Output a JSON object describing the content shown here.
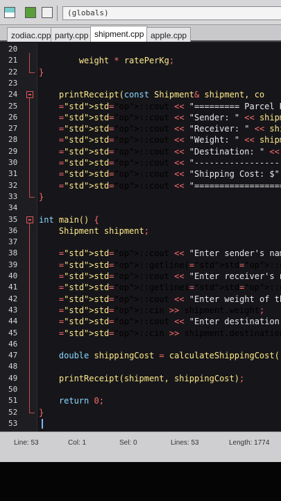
{
  "toolbar": {
    "scope_field": "(globals)"
  },
  "tabs": [
    {
      "label": "zodiac.cpp"
    },
    {
      "label": "party.cpp"
    },
    {
      "label": "shipment.cpp"
    },
    {
      "label": "apple.cpp"
    }
  ],
  "lines": [
    {
      "num": "20",
      "text": ""
    },
    {
      "num": "21",
      "text": "        weight * ratePerKg;"
    },
    {
      "num": "22",
      "text": "}"
    },
    {
      "num": "23",
      "text": ""
    },
    {
      "num": "24",
      "text": "    printReceipt(const Shipment& shipment, co"
    },
    {
      "num": "25",
      "text": "    std::cout << \"========= Parcel Receipt =="
    },
    {
      "num": "26",
      "text": "    std::cout << \"Sender: \" << shipment.sender"
    },
    {
      "num": "27",
      "text": "    std::cout << \"Receiver: \" << shipment.rece"
    },
    {
      "num": "28",
      "text": "    std::cout << \"Weight: \" << shipment.weight"
    },
    {
      "num": "29",
      "text": "    std::cout << \"Destination: \" << shipment.d"
    },
    {
      "num": "30",
      "text": "    std::cout << \"--------------------------------"
    },
    {
      "num": "31",
      "text": "    std::cout << \"Shipping Cost: $\" << std::fi"
    },
    {
      "num": "32",
      "text": "    std::cout << \"=============================="
    },
    {
      "num": "33",
      "text": "}"
    },
    {
      "num": "34",
      "text": ""
    },
    {
      "num": "35",
      "text": "int main() {"
    },
    {
      "num": "36",
      "text": "    Shipment shipment;"
    },
    {
      "num": "37",
      "text": ""
    },
    {
      "num": "38",
      "text": "    std::cout << \"Enter sender's name: \";"
    },
    {
      "num": "39",
      "text": "    std::getline(std::cin >> std::ws, shipment."
    },
    {
      "num": "40",
      "text": "    std::cout << \"Enter receiver's name: \";"
    },
    {
      "num": "41",
      "text": "    std::getline(std::cin >> std::ws, shipment."
    },
    {
      "num": "42",
      "text": "    std::cout << \"Enter weight of the shipment"
    },
    {
      "num": "43",
      "text": "    std::cin >> shipment.weight;"
    },
    {
      "num": "44",
      "text": "    std::cout << \"Enter destination (Domestic or"
    },
    {
      "num": "45",
      "text": "    std::cin >> shipment.destination;"
    },
    {
      "num": "46",
      "text": ""
    },
    {
      "num": "47",
      "text": "    double shippingCost = calculateShippingCost("
    },
    {
      "num": "48",
      "text": ""
    },
    {
      "num": "49",
      "text": "    printReceipt(shipment, shippingCost);"
    },
    {
      "num": "50",
      "text": ""
    },
    {
      "num": "51",
      "text": "    return 0;"
    },
    {
      "num": "52",
      "text": "}"
    },
    {
      "num": "53",
      "text": ""
    }
  ],
  "status": {
    "line_label": "Line:",
    "line_value": "53",
    "col_label": "Col:",
    "col_value": "1",
    "sel_label": "Sel:",
    "sel_value": "0",
    "lines_label": "Lines:",
    "lines_value": "53",
    "length_label": "Length:",
    "length_value": "1774"
  },
  "colors": {
    "keyword": "#ffe066",
    "operator": "#ff6b6b",
    "string": "#e8e8e8",
    "fold_marker": "#e25555",
    "editor_bg": "#16161a"
  }
}
